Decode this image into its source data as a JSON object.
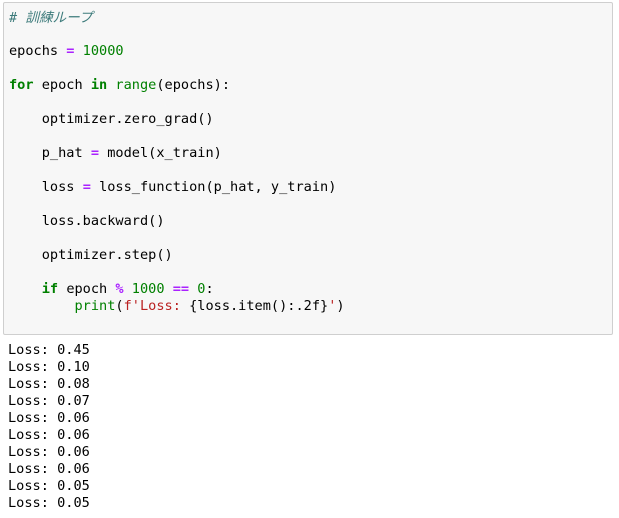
{
  "code_cell": {
    "comment": "# 訓練ループ",
    "line_epochs": {
      "var": "epochs",
      "op": "=",
      "value": "10000"
    },
    "line_for": {
      "kw_for": "for",
      "var": "epoch",
      "kw_in": "in",
      "builtin": "range",
      "args": "(epochs):"
    },
    "line_zero_grad": "optimizer.zero_grad()",
    "line_p_hat": {
      "lhs": "p_hat",
      "op": "=",
      "rhs": "model(x_train)"
    },
    "line_loss": {
      "lhs": "loss",
      "op": "=",
      "rhs": "loss_function(p_hat, y_train)"
    },
    "line_backward": "loss.backward()",
    "line_step": "optimizer.step()",
    "line_if": {
      "kw": "if",
      "var": "epoch",
      "op_mod": "%",
      "num1": "1000",
      "op_eq": "==",
      "num2": "0",
      "colon": ":"
    },
    "line_print": {
      "builtin": "print",
      "open": "(",
      "str1": "f'Loss: ",
      "expr": "{loss.item():.2f}",
      "str2": "'",
      "close": ")"
    }
  },
  "output": {
    "lines": [
      "Loss: 0.45",
      "Loss: 0.10",
      "Loss: 0.08",
      "Loss: 0.07",
      "Loss: 0.06",
      "Loss: 0.06",
      "Loss: 0.06",
      "Loss: 0.06",
      "Loss: 0.05",
      "Loss: 0.05"
    ]
  }
}
